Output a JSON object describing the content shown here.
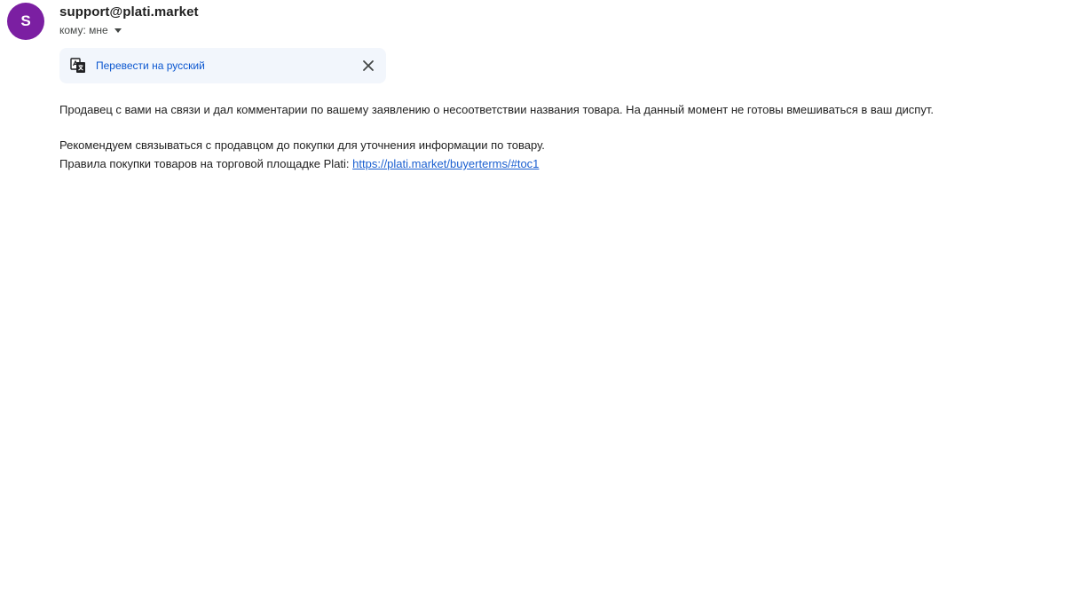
{
  "header": {
    "avatar_letter": "S",
    "sender": "support@plati.market",
    "recipient_label": "кому: мне"
  },
  "translate_bar": {
    "link_label": "Перевести на русский"
  },
  "message": {
    "paragraph1": "Продавец с вами на связи и дал комментарии по вашему заявлению о несоответствии названия товара. На данный момент не готовы вмешиваться в ваш диспут.",
    "paragraph2": "Рекомендуем связываться с продавцом до покупки для уточнения информации по товару.",
    "rules_prefix": "Правила покупки товаров на торговой площадке Plati: ",
    "rules_link": "https://plati.market/buyerterms/#toc1"
  },
  "colors": {
    "avatar_bg": "#7b1fa2",
    "link": "#1a5fd0",
    "translate_bg": "#f2f6fc"
  },
  "icons": {
    "translate": "translate-icon",
    "close": "close-icon",
    "caret": "caret-down-icon"
  }
}
